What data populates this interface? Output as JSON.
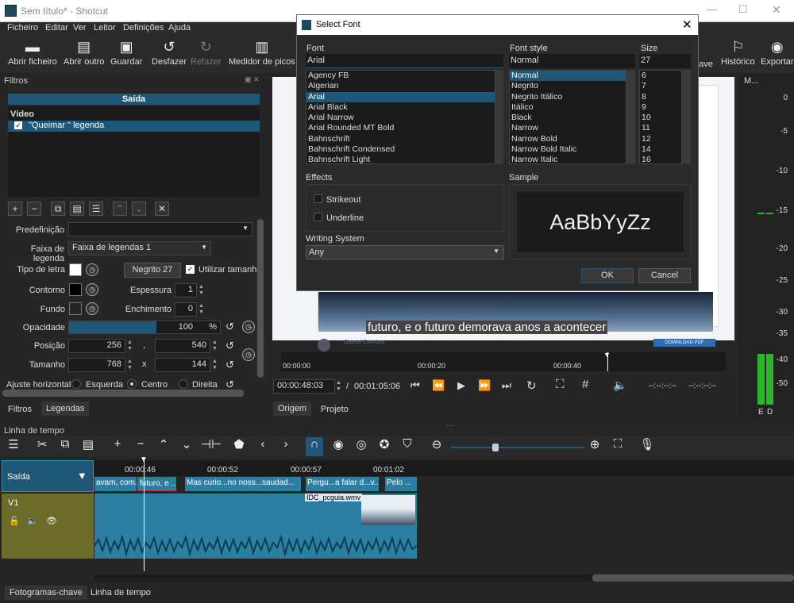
{
  "window": {
    "title": "Sem título* - Shotcut"
  },
  "menu": [
    "Ficheiro",
    "Editar",
    "Ver",
    "Leitor",
    "Definições",
    "Ajuda"
  ],
  "toolbar": {
    "open_file": "Abrir ficheiro",
    "open_other": "Abrir outro",
    "save": "Guardar",
    "undo": "Desfazer",
    "redo": "Refazer",
    "peak_meter": "Medidor de picos",
    "keyframes_partial": "have",
    "history": "Histórico",
    "export": "Exportar"
  },
  "filters": {
    "panel_title": "Filtros",
    "output_title": "Saída",
    "video_header": "Vídeo",
    "filter_item": "\"Queimar \" legenda",
    "preset_label": "Predefinição",
    "preset_value": "",
    "track_label": "Faixa de legenda",
    "track_value": "Faixa de legendas 1",
    "font_label": "Tipo de letra",
    "font_button": "Negrito 27",
    "use_size_label": "Utilizar tamanho",
    "outline_label": "Contorno",
    "thickness_label": "Espessura",
    "thickness_value": "1",
    "bg_label": "Fundo",
    "padding_label": "Enchimento",
    "padding_value": "0",
    "opacity_label": "Opacidade",
    "opacity_value": "100",
    "opacity_unit": "%",
    "opacity_fraction": 0.58,
    "position_label": "Posição",
    "pos_x": "256",
    "pos_sep": ",",
    "pos_y": "540",
    "size_label": "Tamanho",
    "size_w": "768",
    "size_sep": "x",
    "size_h": "144",
    "halign_label": "Ajuste horizontal",
    "halign_left": "Esquerda",
    "halign_center": "Centro",
    "halign_right": "Direita",
    "tab_filters": "Filtros",
    "tab_subtitles": "Legendas"
  },
  "dialog": {
    "title": "Select Font",
    "font_header": "Font",
    "font_value": "Arial",
    "fonts": [
      "Agency FB",
      "Algerian",
      "Arial",
      "Arial Black",
      "Arial Narrow",
      "Arial Rounded MT Bold",
      "Bahnschrift",
      "Bahnschrift Condensed",
      "Bahnschrift Light"
    ],
    "selected_font_index": 2,
    "style_header": "Font style",
    "style_value": "Normal",
    "styles": [
      "Normal",
      "Negrito",
      "Negrito Itálico",
      "Itálico",
      "Black",
      "Narrow",
      "Narrow Bold",
      "Narrow Bold Italic",
      "Narrow Italic"
    ],
    "selected_style_index": 0,
    "size_header": "Size",
    "size_value": "27",
    "sizes": [
      "6",
      "7",
      "8",
      "9",
      "10",
      "11",
      "12",
      "14",
      "16"
    ],
    "effects_header": "Effects",
    "strikeout": "Strikeout",
    "underline": "Underline",
    "sample_header": "Sample",
    "sample_text": "AaBbYyZz",
    "writing_header": "Writing System",
    "writing_value": "Any",
    "ok": "OK",
    "cancel": "Cancel"
  },
  "player": {
    "subtitle_text": "futuro, e o futuro demorava anos a acontecer",
    "author_text": "Gabriel Coimbra",
    "download_text": "DOWNLOAD PDF",
    "ruler": [
      "00:00:00",
      "00:00:20",
      "00:00:40"
    ],
    "current_time": "00:00:48:03",
    "duration": "00:01:05:06",
    "in_point": "--:--:--:--",
    "out_point": "--:--:--:--",
    "tab_source": "Origem",
    "tab_project": "Projeto"
  },
  "meter": {
    "title": "M...",
    "ticks": [
      "0",
      "-5",
      "-10",
      "-15",
      "-20",
      "-25",
      "-30",
      "-35",
      "-40",
      "-50"
    ],
    "left": "E",
    "right": "D"
  },
  "timeline": {
    "title": "Linha de tempo",
    "output_track": "Saída",
    "video_track": "V1",
    "ruler": [
      "00:00:46",
      "00:00:52",
      "00:00:57",
      "00:01:02"
    ],
    "subtitle_clips": [
      "avam, com...",
      "futuro, e ...",
      "Mas curio...no noss...saudad...",
      "Pergu...a falar d...v...",
      "Pelo ..."
    ],
    "video_clip": "IDC_pcguia.wmv",
    "tab_keyframes": "Fotogramas-chave",
    "tab_timeline": "Linha de tempo"
  },
  "colors": {
    "accent": "#1e5777",
    "track_output": "#1e5777",
    "track_video": "#6b6b2a",
    "clip": "#2a7fa3",
    "meter_green": "#2bb62b"
  }
}
